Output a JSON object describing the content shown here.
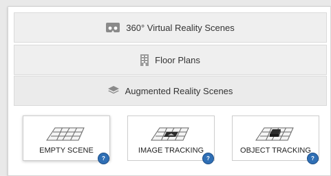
{
  "sections": [
    {
      "label": "360° Virtual Reality Scenes",
      "icon": "vr-headset-icon"
    },
    {
      "label": "Floor Plans",
      "icon": "building-icon"
    },
    {
      "label": "Augmented Reality Scenes",
      "icon": "layers-icon"
    }
  ],
  "cards": [
    {
      "label": "EMPTY SCENE",
      "help": "?",
      "icon": "empty-grid-icon"
    },
    {
      "label": "IMAGE TRACKING",
      "help": "?",
      "icon": "image-tracking-icon"
    },
    {
      "label": "OBJECT TRACKING",
      "help": "?",
      "icon": "object-tracking-icon"
    }
  ],
  "colors": {
    "help_badge": "#2f6fb5",
    "header_background": "#efefef"
  }
}
